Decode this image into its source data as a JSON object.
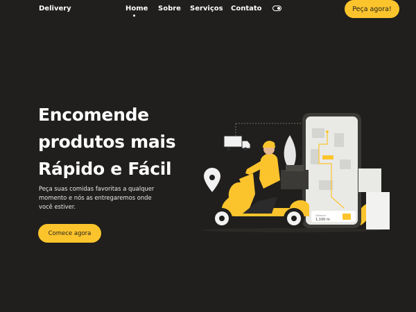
{
  "header": {
    "logo": "Delivery",
    "nav": [
      {
        "label": "Home",
        "active": true
      },
      {
        "label": "Sobre",
        "active": false
      },
      {
        "label": "Serviços",
        "active": false
      },
      {
        "label": "Contato",
        "active": false
      }
    ],
    "order_button": "Peça agora!"
  },
  "hero": {
    "title_lines": [
      "Encomende",
      "produtos mais",
      "Rápido e Fácil"
    ],
    "description_lines": [
      "Peça suas comidas favoritas a qualquer",
      "momento e nós as entregaremos onde",
      "você estiver."
    ],
    "cta_button": "Comece agora"
  },
  "illustration": {
    "distance_label": "Distance",
    "distance_value": "1,100 m"
  },
  "colors": {
    "background": "#201f1d",
    "accent": "#fcc42c",
    "text": "#ffffff"
  },
  "icons": [
    "toggle-icon",
    "location-pin-icon",
    "delivery-truck-icon"
  ]
}
